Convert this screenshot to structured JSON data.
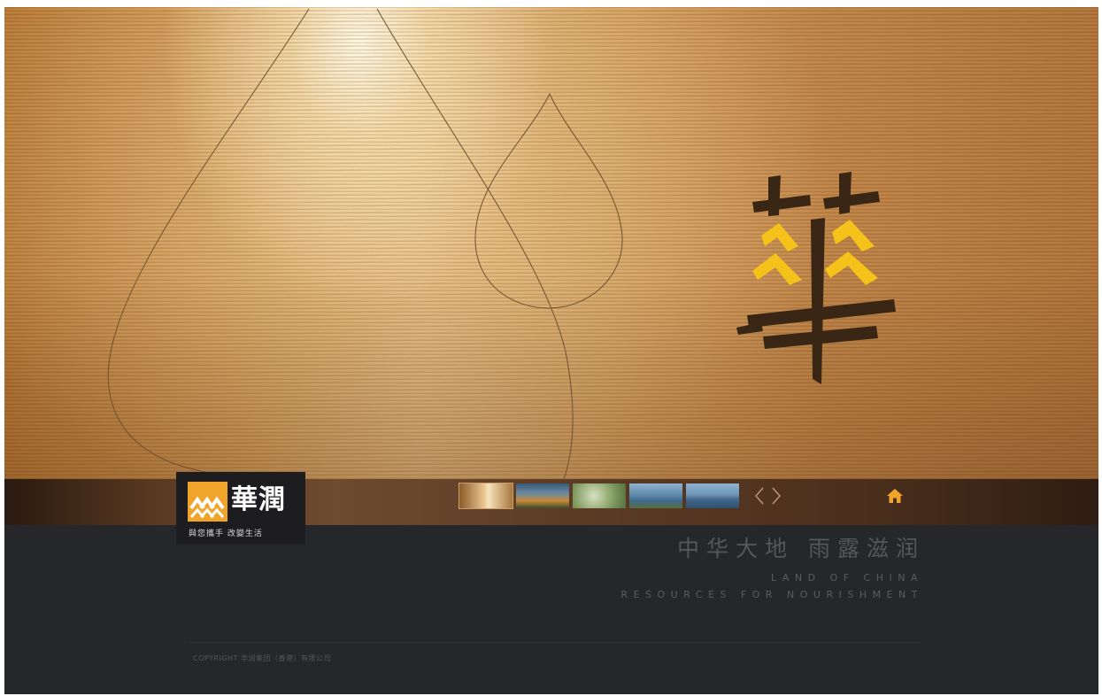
{
  "brand": {
    "name": "華潤",
    "slogan": "與您攜手 改變生活",
    "colors": {
      "accent": "#f0a52a",
      "gold": "#f5c21a",
      "ink": "#3a2614",
      "footer_bg": "#26272b"
    }
  },
  "hero": {
    "calligraphy": "華"
  },
  "thumbnails": [
    {
      "name": "golden water"
    },
    {
      "name": "landscape"
    },
    {
      "name": "terraced fields"
    },
    {
      "name": "lake"
    },
    {
      "name": "harbour city"
    }
  ],
  "nav": {
    "prev_icon": "chevron-left-icon",
    "next_icon": "chevron-right-icon",
    "home_icon": "home-icon"
  },
  "tagline": {
    "chinese": "中华大地 雨露滋润",
    "english_line1": "LAND OF CHINA",
    "english_line2": "RESOURCES FOR NOURISHMENT"
  },
  "footer": {
    "copyright": "COPYRIGHT 华润集团（香港）有限公司"
  }
}
